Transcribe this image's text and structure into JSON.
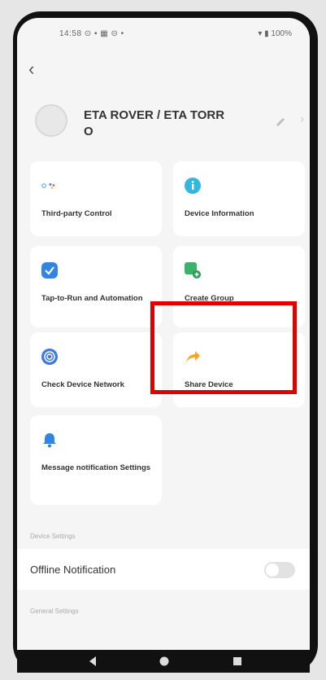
{
  "status": {
    "left": "14:58  ⊙  ▪  ▦  ⊝  •",
    "right": "▾ ▮ 100%"
  },
  "device": {
    "name_line1": "ETA ROVER / ETA TORR",
    "name_line2": "O"
  },
  "cards": [
    {
      "label": "Third-party Control",
      "icon": "assistants-icon"
    },
    {
      "label": "Device Information",
      "icon": "info-icon"
    },
    {
      "label": "Tap-to-Run and Automation",
      "icon": "check-shield-icon"
    },
    {
      "label": "Create Group",
      "icon": "create-group-icon"
    },
    {
      "label": "Check Device Network",
      "icon": "network-icon"
    },
    {
      "label": "Share Device",
      "icon": "share-icon"
    },
    {
      "label": "Message notification Settings",
      "icon": "bell-icon"
    }
  ],
  "sections": {
    "device_settings": "Device Settings",
    "general_settings": "General Settings"
  },
  "offline_notification": {
    "label": "Offline Notification",
    "enabled": false
  },
  "colors": {
    "highlight": "#e00000",
    "share": "#f5a623",
    "info": "#35b6e0",
    "group": "#3bb16a",
    "bell": "#2f84e6"
  }
}
